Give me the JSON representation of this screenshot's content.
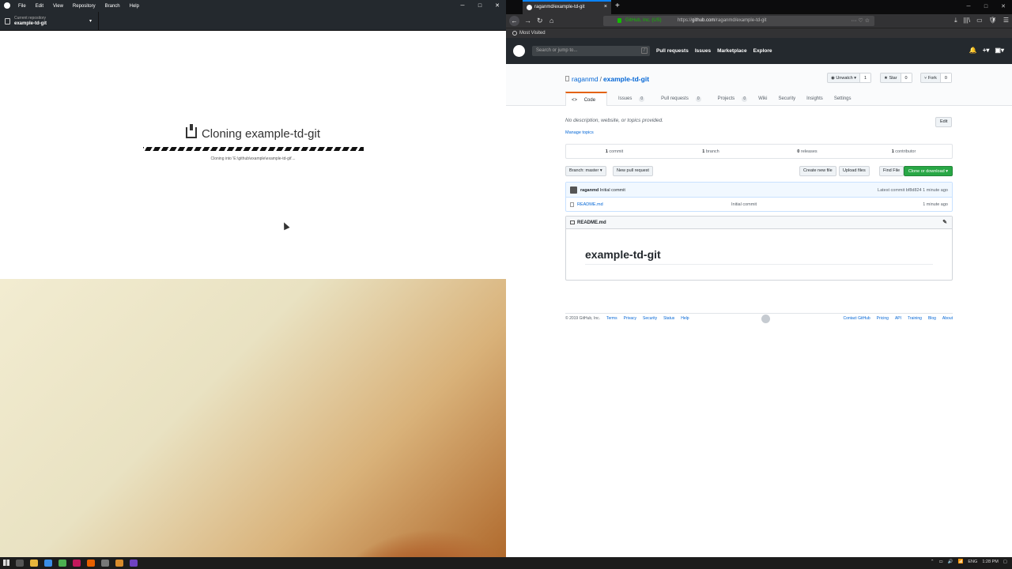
{
  "desktop_app": {
    "menu": [
      "File",
      "Edit",
      "View",
      "Repository",
      "Branch",
      "Help"
    ],
    "window_controls": [
      "─",
      "□",
      "✕"
    ],
    "current_repo_label": "Current repository",
    "current_repo_name": "example-td-git",
    "caret": "▾",
    "clone_title": "Cloning example-td-git",
    "clone_status": "Cloning into 'E:\\github\\example\\example-td-git'..."
  },
  "browser": {
    "tab_title": "raganmd/example-td-git",
    "tab_close": "×",
    "new_tab": "+",
    "window_controls": [
      "─",
      "□",
      "✕"
    ],
    "nav": {
      "back": "←",
      "forward": "→",
      "reload": "↻",
      "home": "⌂"
    },
    "url_identity": "GitHub, Inc. (US)",
    "url_prefix": "https://",
    "url_host": "github.com",
    "url_path": "/raganmd/example-td-git",
    "url_actions": "··· ♡ ☆",
    "toolbar_icons": [
      "⤓",
      "|||\\",
      "▭",
      "🛡",
      "☰"
    ],
    "bookmark": "Most Visited"
  },
  "github": {
    "search_placeholder": "Search or jump to...",
    "search_key": "/",
    "nav": [
      "Pull requests",
      "Issues",
      "Marketplace",
      "Explore"
    ],
    "header_icons": [
      "🔔",
      "+▾",
      "▣▾"
    ],
    "owner": "raganmd",
    "separator": "/",
    "repo": "example-td-git",
    "watch": {
      "label": "◉ Unwatch ▾",
      "count": "1"
    },
    "star": {
      "label": "★ Star",
      "count": "0"
    },
    "fork": {
      "label": "⑂ Fork",
      "count": "0"
    },
    "tabs": [
      {
        "label": "Code",
        "count": ""
      },
      {
        "label": "Issues",
        "count": "0"
      },
      {
        "label": "Pull requests",
        "count": "0"
      },
      {
        "label": "Projects",
        "count": "0"
      },
      {
        "label": "Wiki",
        "count": ""
      },
      {
        "label": "Security",
        "count": ""
      },
      {
        "label": "Insights",
        "count": ""
      },
      {
        "label": "Settings",
        "count": ""
      }
    ],
    "description": "No description, website, or topics provided.",
    "manage_topics": "Manage topics",
    "edit": "Edit",
    "stats": {
      "commits": {
        "n": "1",
        "label": " commit"
      },
      "branches": {
        "n": "1",
        "label": " branch"
      },
      "releases": {
        "n": "0",
        "label": " releases"
      },
      "contributors": {
        "n": "1",
        "label": " contributor"
      }
    },
    "branch_button": "Branch: master ▾",
    "new_pr": "New pull request",
    "create_file": "Create new file",
    "upload_files": "Upload files",
    "find_file": "Find File",
    "clone_download": "Clone or download ▾",
    "commit_author": "raganmd",
    "commit_message": "Initial commit",
    "latest_commit": "Latest commit bf8d824 1 minute ago",
    "file": {
      "name": "README.md",
      "commit": "Initial commit",
      "age": "1 minute ago"
    },
    "readme_header": "README.md",
    "readme_pen": "✎",
    "readme_title": "example-td-git",
    "footer_left": [
      "© 2019 GitHub, Inc.",
      "Terms",
      "Privacy",
      "Security",
      "Status",
      "Help"
    ],
    "footer_right": [
      "Contact GitHub",
      "Pricing",
      "API",
      "Training",
      "Blog",
      "About"
    ]
  },
  "taskbar": {
    "tray": [
      "⌃",
      "▭",
      "🔊",
      "📶",
      "ENG"
    ],
    "clock": "1:28 PM",
    "notify": "▢"
  },
  "colors": {
    "github_green": "#28a745",
    "link": "#0366d6",
    "dark": "#24292e",
    "tab_accent": "#e36209"
  }
}
